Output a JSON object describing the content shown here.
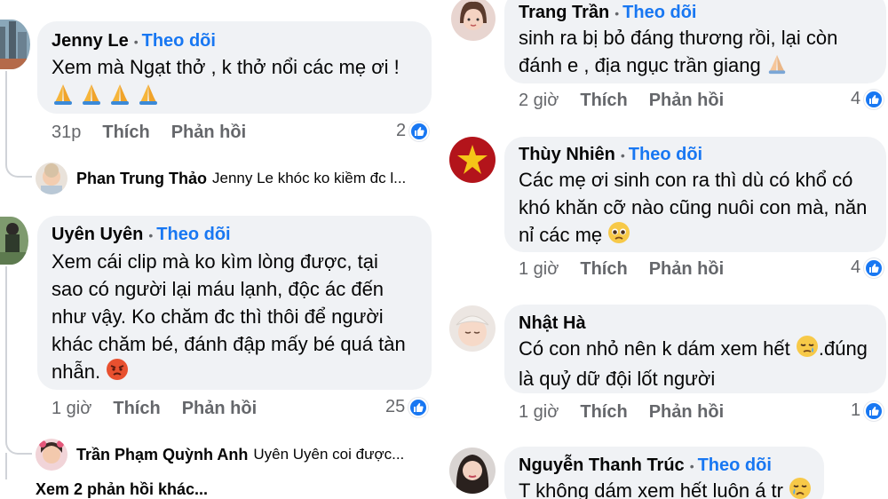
{
  "left_comments": [
    {
      "author": "Jenny Le",
      "follow": "Theo dõi",
      "lines": [
        "Xem mà Ngạt thở , k thở nổi các mẹ ơi !"
      ],
      "time": "31p",
      "like": "Thích",
      "reply": "Phản hồi",
      "reactions": "2"
    },
    {
      "author": "Uyên Uyên",
      "follow": "Theo dõi",
      "lines": [
        "Xem cái clip mà ko kìm lòng được, tại",
        "sao có người lại máu lạnh, độc ác đến",
        "như vậy. Ko chăm đc thì thôi để người",
        "khác chăm bé, đánh đập mấy bé quá tàn",
        "nhẫn."
      ],
      "time": "1 giờ",
      "like": "Thích",
      "reply": "Phản hồi",
      "reactions": "25"
    }
  ],
  "left_replies": [
    {
      "author": "Phan Trung Thảo",
      "text": "Jenny Le khóc ko kiềm đc l..."
    },
    {
      "author": "Trần Phạm Quỳnh Anh",
      "text": "Uyên Uyên coi được..."
    }
  ],
  "more_replies": "Xem 2 phản hồi khác...",
  "right_comments": [
    {
      "author": "Trang Trần",
      "follow": "Theo dõi",
      "lines": [
        "sinh ra bị bỏ đáng thương rồi, lại còn",
        "đánh e , địa ngục trần giang"
      ],
      "time": "2 giờ",
      "like": "Thích",
      "reply": "Phản hồi",
      "reactions": "4"
    },
    {
      "author": "Thùy Nhiên",
      "follow": "Theo dõi",
      "lines": [
        "Các mẹ ơi sinh con ra thì dù có khổ có",
        "khó khăn cỡ nào cũng nuôi con mà, năn",
        "nỉ các mẹ"
      ],
      "time": "1 giờ",
      "like": "Thích",
      "reply": "Phản hồi",
      "reactions": "4"
    },
    {
      "author": "Nhật Hà",
      "follow": "",
      "lines": [
        "Có con nhỏ nên k dám xem hết",
        "là quỷ dữ đội lốt người"
      ],
      "line1_suffix": ".đúng",
      "time": "1 giờ",
      "like": "Thích",
      "reply": "Phản hồi",
      "reactions": "1"
    },
    {
      "author": "Nguyễn Thanh Trúc",
      "follow": "Theo dõi",
      "lines": [
        "T không dám xem hết luôn á tr"
      ]
    }
  ],
  "colors": {
    "accent": "#1877f2",
    "bubble": "#f0f2f5",
    "muted": "#65676b"
  },
  "icons": [
    "like-reaction-icon",
    "folded-hands-emoji",
    "angry-face-emoji",
    "pleading-face-emoji",
    "crying-face-emoji",
    "sleepy-face-emoji"
  ]
}
